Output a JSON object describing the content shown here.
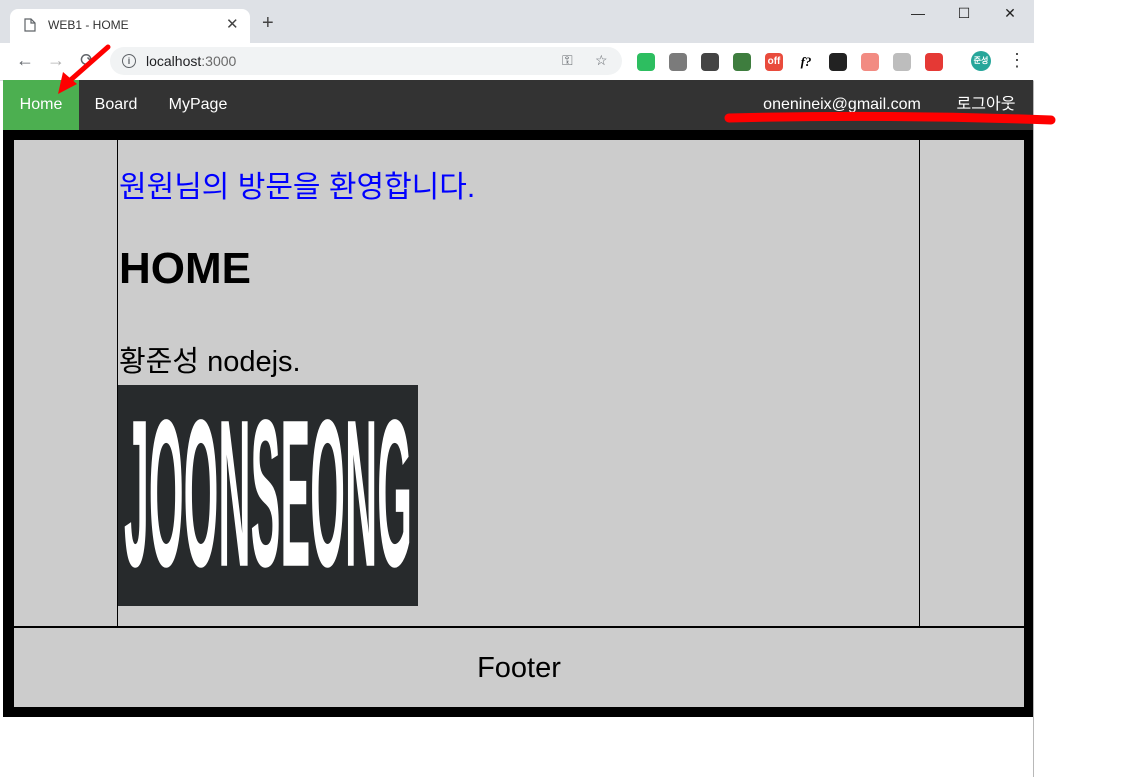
{
  "browser": {
    "tab_title": "WEB1 - HOME",
    "tab_close": "✕",
    "new_tab": "+",
    "window_controls": {
      "minimize": "—",
      "maximize": "☐",
      "close": "✕"
    },
    "nav": {
      "back": "←",
      "forward": "→",
      "reload": "⟳"
    },
    "url_host": "localhost",
    "url_port": ":3000",
    "omnibox_icons": {
      "key": "⚿",
      "star": "☆"
    },
    "extensions": [
      {
        "name": "evernote-icon",
        "color": "#2dbe60",
        "label": ""
      },
      {
        "name": "chat-extension-icon",
        "color": "#7b7b7b",
        "label": ""
      },
      {
        "name": "incognito-extension-icon",
        "color": "#444444",
        "label": ""
      },
      {
        "name": "eyedropper-extension-icon",
        "color": "#3e7d3e",
        "label": ""
      },
      {
        "name": "off-extension-icon",
        "color": "#e94b3c",
        "label": "off"
      },
      {
        "name": "font-extension-icon",
        "color": "#ffffff",
        "label": "f?"
      },
      {
        "name": "color-wheel-extension-icon",
        "color": "#222222",
        "label": ""
      },
      {
        "name": "arrow-extension-icon",
        "color": "#f28b82",
        "label": ""
      },
      {
        "name": "shortcut-extension-icon",
        "color": "#bdbdbd",
        "label": ""
      },
      {
        "name": "sync-extension-icon",
        "color": "#e53935",
        "label": ""
      }
    ],
    "profile_avatar": "준성",
    "menu_icon": "⋮"
  },
  "navbar": {
    "items": [
      {
        "label": "Home"
      },
      {
        "label": "Board"
      },
      {
        "label": "MyPage"
      }
    ],
    "user_email": "onenineix@gmail.com",
    "logout_label": "로그아웃",
    "active_color": "#4caf50",
    "background_color": "#333333"
  },
  "main": {
    "welcome": "원원님의 방문을 환영합니다.",
    "heading": "HOME",
    "description": "황준성 nodejs.",
    "logo_text": "JOONSEONG"
  },
  "footer": {
    "text": "Footer"
  },
  "annotations": {
    "color": "#ff0000"
  }
}
